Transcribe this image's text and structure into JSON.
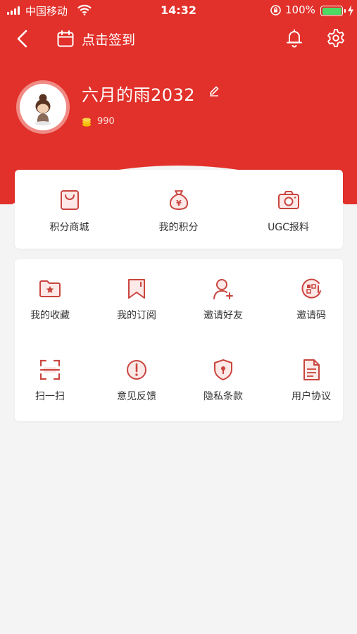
{
  "status_bar": {
    "carrier": "中国移动",
    "time": "14:32",
    "battery": "100%"
  },
  "nav": {
    "checkin_label": "点击签到",
    "back_icon": "chevron-left-icon",
    "bell_icon": "bell-icon",
    "settings_icon": "gear-icon"
  },
  "profile": {
    "name": "六月的雨2032",
    "points": "990"
  },
  "quick_actions": [
    {
      "label": "积分商城",
      "icon": "shopping-bag-icon"
    },
    {
      "label": "我的积分",
      "icon": "money-bag-icon"
    },
    {
      "label": "UGC报料",
      "icon": "camera-icon"
    }
  ],
  "menu": [
    {
      "label": "我的收藏",
      "icon": "folder-star-icon"
    },
    {
      "label": "我的订阅",
      "icon": "bookmark-icon"
    },
    {
      "label": "邀请好友",
      "icon": "add-user-icon"
    },
    {
      "label": "邀请码",
      "icon": "invite-code-icon"
    },
    {
      "label": "扫一扫",
      "icon": "scan-icon"
    },
    {
      "label": "意见反馈",
      "icon": "feedback-icon"
    },
    {
      "label": "隐私条款",
      "icon": "shield-icon"
    },
    {
      "label": "用户协议",
      "icon": "document-icon"
    }
  ],
  "colors": {
    "brand_red": "#e2302a",
    "icon_red": "#c9453f",
    "background": "#f4f4f5"
  }
}
